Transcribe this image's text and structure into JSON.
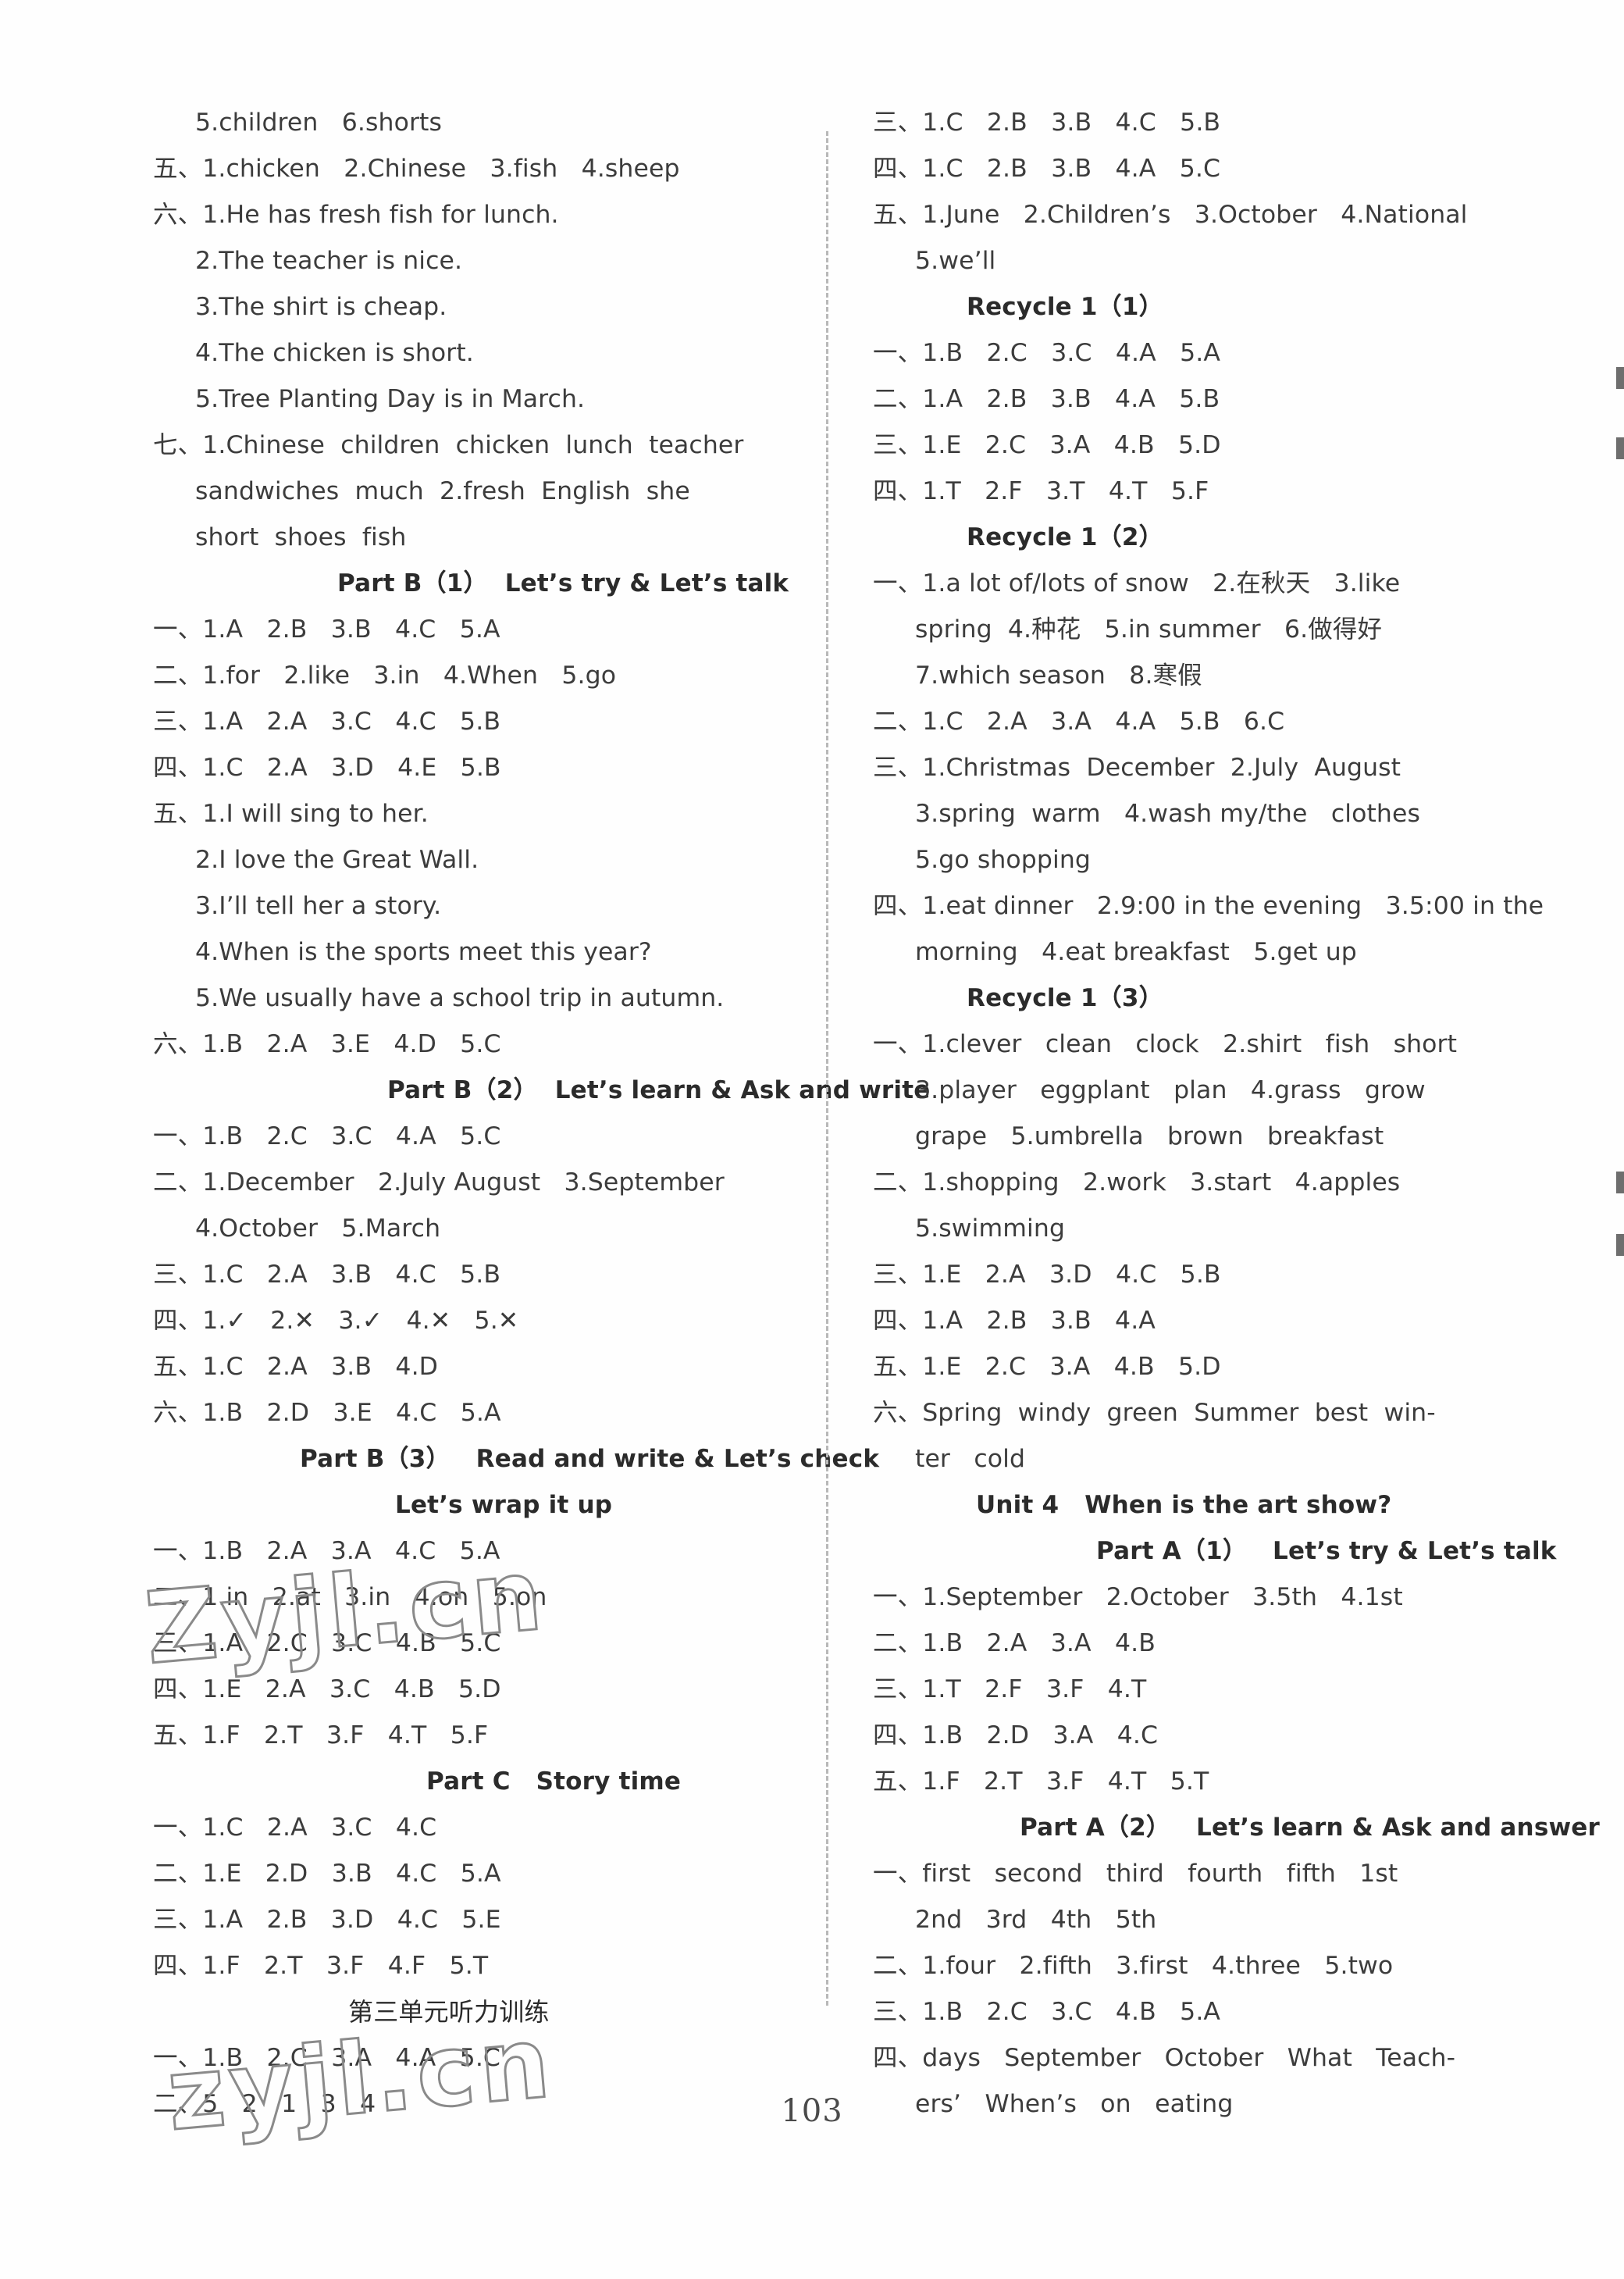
{
  "page": {
    "number": "103",
    "watermarks": [
      "Zyjl.cn",
      "zyjl.cn"
    ]
  },
  "left_column": {
    "blocks": [
      {
        "type": "line",
        "indent": true,
        "text": "5.children   6.shorts"
      },
      {
        "type": "line",
        "indent": false,
        "text": "五、1.chicken   2.Chinese   3.fish   4.sheep"
      },
      {
        "type": "line",
        "indent": false,
        "text": "六、1.He has fresh fish for lunch."
      },
      {
        "type": "line",
        "indent": true,
        "text": "2.The teacher is nice."
      },
      {
        "type": "line",
        "indent": true,
        "text": "3.The shirt is cheap."
      },
      {
        "type": "line",
        "indent": true,
        "text": "4.The chicken is short."
      },
      {
        "type": "line",
        "indent": true,
        "text": "5.Tree Planting Day is in March."
      },
      {
        "type": "line",
        "indent": false,
        "text": "七、1.Chinese  children  chicken  lunch  teacher"
      },
      {
        "type": "line",
        "indent": true,
        "text": "sandwiches  much  2.fresh  English  she"
      },
      {
        "type": "line",
        "indent": true,
        "text": "short  shoes  fish"
      },
      {
        "type": "heading",
        "pos": "c1",
        "text": "Part B（1）  Let’s try & Let’s talk"
      },
      {
        "type": "line",
        "indent": false,
        "text": "一、1.A   2.B   3.B   4.C   5.A"
      },
      {
        "type": "line",
        "indent": false,
        "text": "二、1.for   2.like   3.in   4.When   5.go"
      },
      {
        "type": "line",
        "indent": false,
        "text": "三、1.A   2.A   3.C   4.C   5.B"
      },
      {
        "type": "line",
        "indent": false,
        "text": "四、1.C   2.A   3.D   4.E   5.B"
      },
      {
        "type": "line",
        "indent": false,
        "text": "五、1.I will sing to her."
      },
      {
        "type": "line",
        "indent": true,
        "text": "2.I love the Great Wall."
      },
      {
        "type": "line",
        "indent": true,
        "text": "3.I’ll tell her a story."
      },
      {
        "type": "line",
        "indent": true,
        "text": "4.When is the sports meet this year?"
      },
      {
        "type": "line",
        "indent": true,
        "text": "5.We usually have a school trip in autumn."
      },
      {
        "type": "line",
        "indent": false,
        "text": "六、1.B   2.A   3.E   4.D   5.C"
      },
      {
        "type": "heading",
        "pos": "c2",
        "text": "Part B（2）  Let’s learn & Ask and write"
      },
      {
        "type": "line",
        "indent": false,
        "text": "一、1.B   2.C   3.C   4.A   5.C"
      },
      {
        "type": "line",
        "indent": false,
        "text": "二、1.December   2.July August   3.September"
      },
      {
        "type": "line",
        "indent": true,
        "text": "4.October   5.March"
      },
      {
        "type": "line",
        "indent": false,
        "text": "三、1.C   2.A   3.B   4.C   5.B"
      },
      {
        "type": "line",
        "indent": false,
        "text": "四、1.✓   2.✕   3.✓   4.✕   5.✕"
      },
      {
        "type": "line",
        "indent": false,
        "text": "五、1.C   2.A   3.B   4.D"
      },
      {
        "type": "line",
        "indent": false,
        "text": "六、1.B   2.D   3.E   4.C   5.A"
      },
      {
        "type": "heading",
        "pos": "c3",
        "text": "Part B（3）   Read and write & Let’s check"
      },
      {
        "type": "heading",
        "pos": "c5",
        "text": "Let’s wrap it up"
      },
      {
        "type": "line",
        "indent": false,
        "text": "一、1.B   2.A   3.A   4.C   5.A"
      },
      {
        "type": "line",
        "indent": false,
        "text": "二、1.in   2.at   3.in   4.on   5.on"
      },
      {
        "type": "line",
        "indent": false,
        "text": "三、1.A   2.C   3.C   4.B   5.C"
      },
      {
        "type": "line",
        "indent": false,
        "text": "四、1.E   2.A   3.C   4.B   5.D"
      },
      {
        "type": "line",
        "indent": false,
        "text": "五、1.F   2.T   3.F   4.T   5.F"
      },
      {
        "type": "heading",
        "pos": "c7",
        "text": "Part C   Story time"
      },
      {
        "type": "line",
        "indent": false,
        "text": "一、1.C   2.A   3.C   4.C"
      },
      {
        "type": "line",
        "indent": false,
        "text": "二、1.E   2.D   3.B   4.C   5.A"
      },
      {
        "type": "line",
        "indent": false,
        "text": "三、1.A   2.B   3.D   4.C   5.E"
      },
      {
        "type": "line",
        "indent": false,
        "text": "四、1.F   2.T   3.F   4.F   5.T"
      },
      {
        "type": "heading",
        "pos": "c1",
        "zh": true,
        "text": "第三单元听力训练"
      },
      {
        "type": "line",
        "indent": false,
        "text": "一、1.B   2.C   3.A   4.A   5.C"
      },
      {
        "type": "line",
        "indent": false,
        "text": "二、5   2   1   3   4"
      }
    ]
  },
  "right_column": {
    "blocks": [
      {
        "type": "line",
        "indent": false,
        "text": "三、1.C   2.B   3.B   4.C   5.B"
      },
      {
        "type": "line",
        "indent": false,
        "text": "四、1.C   2.B   3.B   4.A   5.C"
      },
      {
        "type": "line",
        "indent": false,
        "text": "五、1.June   2.Children’s   3.October   4.National"
      },
      {
        "type": "line",
        "indent": true,
        "text": "5.we’ll"
      },
      {
        "type": "heading",
        "pos": "c4",
        "text": "Recycle 1（1）"
      },
      {
        "type": "line",
        "indent": false,
        "text": "一、1.B   2.C   3.C   4.A   5.A"
      },
      {
        "type": "line",
        "indent": false,
        "text": "二、1.A   2.B   3.B   4.A   5.B"
      },
      {
        "type": "line",
        "indent": false,
        "text": "三、1.E   2.C   3.A   4.B   5.D"
      },
      {
        "type": "line",
        "indent": false,
        "text": "四、1.T   2.F   3.T   4.T   5.F"
      },
      {
        "type": "heading",
        "pos": "c4",
        "text": "Recycle 1（2）"
      },
      {
        "type": "line",
        "indent": false,
        "text": "一、1.a lot of/lots of snow   2.在秋天   3.like"
      },
      {
        "type": "line",
        "indent": true,
        "text": "spring  4.种花   5.in summer   6.做得好"
      },
      {
        "type": "line",
        "indent": true,
        "text": "7.which season   8.寒假"
      },
      {
        "type": "line",
        "indent": false,
        "text": "二、1.C   2.A   3.A   4.A   5.B   6.C"
      },
      {
        "type": "line",
        "indent": false,
        "text": "三、1.Christmas  December  2.July  August"
      },
      {
        "type": "line",
        "indent": true,
        "text": "3.spring  warm   4.wash my/the   clothes"
      },
      {
        "type": "line",
        "indent": true,
        "text": "5.go shopping"
      },
      {
        "type": "line",
        "indent": false,
        "text": "四、1.eat dinner   2.9:00 in the evening   3.5:00 in the"
      },
      {
        "type": "line",
        "indent": true,
        "text": "morning   4.eat breakfast   5.get up"
      },
      {
        "type": "heading",
        "pos": "c4",
        "text": "Recycle 1（3）"
      },
      {
        "type": "line",
        "indent": false,
        "text": "一、1.clever   clean   clock   2.shirt   fish   short"
      },
      {
        "type": "line",
        "indent": true,
        "text": "3.player   eggplant   plan   4.grass   grow"
      },
      {
        "type": "line",
        "indent": true,
        "text": "grape   5.umbrella   brown   breakfast"
      },
      {
        "type": "line",
        "indent": false,
        "text": "二、1.shopping   2.work   3.start   4.apples"
      },
      {
        "type": "line",
        "indent": true,
        "text": "5.swimming"
      },
      {
        "type": "line",
        "indent": false,
        "text": "三、1.E   2.A   3.D   4.C   5.B"
      },
      {
        "type": "line",
        "indent": false,
        "text": "四、1.A   2.B   3.B   4.A"
      },
      {
        "type": "line",
        "indent": false,
        "text": "五、1.E   2.C   3.A   4.B   5.D"
      },
      {
        "type": "line",
        "indent": false,
        "text": "六、Spring  windy  green  Summer  best  win-"
      },
      {
        "type": "line",
        "indent": true,
        "text": "ter   cold"
      },
      {
        "type": "heading",
        "pos": "c6",
        "text": "Unit 4   When is the art show?"
      },
      {
        "type": "heading",
        "pos": "c8",
        "text": "Part A（1）   Let’s try & Let’s talk"
      },
      {
        "type": "line",
        "indent": false,
        "text": "一、1.September   2.October   3.5th   4.1st"
      },
      {
        "type": "line",
        "indent": false,
        "text": "二、1.B   2.A   3.A   4.B"
      },
      {
        "type": "line",
        "indent": false,
        "text": "三、1.T   2.F   3.F   4.T"
      },
      {
        "type": "line",
        "indent": false,
        "text": "四、1.B   2.D   3.A   4.C"
      },
      {
        "type": "line",
        "indent": false,
        "text": "五、1.F   2.T   3.F   4.T   5.T"
      },
      {
        "type": "heading",
        "pos": "c3",
        "text": "Part A（2）   Let’s learn & Ask and answer"
      },
      {
        "type": "line",
        "indent": false,
        "text": "一、first   second   third   fourth   fifth   1st"
      },
      {
        "type": "line",
        "indent": true,
        "text": "2nd   3rd   4th   5th"
      },
      {
        "type": "line",
        "indent": false,
        "text": "二、1.four   2.fifth   3.first   4.three   5.two"
      },
      {
        "type": "line",
        "indent": false,
        "text": "三、1.B   2.C   3.C   4.B   5.A"
      },
      {
        "type": "line",
        "indent": false,
        "text": "四、days   September   October   What   Teach-"
      },
      {
        "type": "line",
        "indent": true,
        "text": "ers’   When’s   on   eating"
      }
    ]
  }
}
